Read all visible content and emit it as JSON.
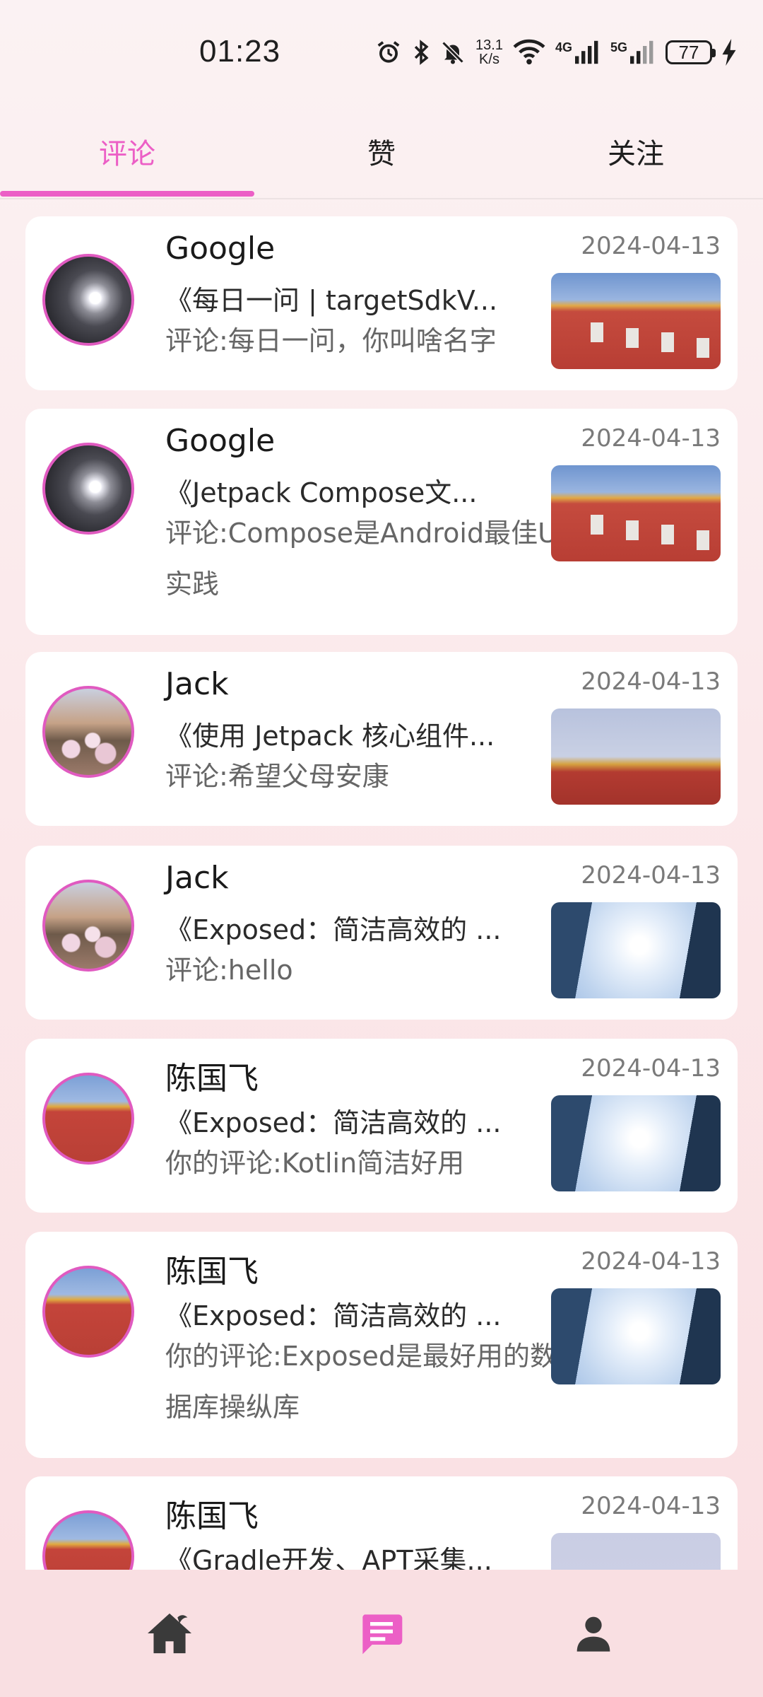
{
  "status_bar": {
    "time": "01:23",
    "net_speed_value": "13.1",
    "net_speed_unit": "K/s",
    "signal_1_label": "4G",
    "signal_2_label": "5G",
    "battery": "77"
  },
  "tabs": [
    {
      "label": "评论",
      "active": true
    },
    {
      "label": "赞",
      "active": false
    },
    {
      "label": "关注",
      "active": false
    }
  ],
  "accent_color": "#ec5fc6",
  "items": [
    {
      "name": "Google",
      "date": "2024-04-13",
      "article": "《每日一问 | targetSdkV...",
      "comment": "评论:每日一问，你叫啥名字",
      "avatar": "moon-night-avatar",
      "thumb": "palace-wall-thumbnail"
    },
    {
      "name": "Google",
      "date": "2024-04-13",
      "article": "《Jetpack Compose文...",
      "comment": "评论:Compose是Android最佳UI实践",
      "avatar": "moon-night-avatar",
      "thumb": "palace-wall-thumbnail"
    },
    {
      "name": "Jack",
      "date": "2024-04-13",
      "article": "《使用 Jetpack 核心组件...",
      "comment": "评论:希望父母安康",
      "avatar": "blossom-avatar",
      "thumb": "palace-gate-thumbnail"
    },
    {
      "name": "Jack",
      "date": "2024-04-13",
      "article": "《Exposed：简洁高效的 ...",
      "comment": "评论:hello",
      "avatar": "blossom-avatar",
      "thumb": "sky-buildings-thumbnail"
    },
    {
      "name": "陈国飞",
      "date": "2024-04-13",
      "article": "《Exposed：简洁高效的 ...",
      "comment": "你的评论:Kotlin简洁好用",
      "avatar": "palace-avatar",
      "thumb": "sky-buildings-thumbnail"
    },
    {
      "name": "陈国飞",
      "date": "2024-04-13",
      "article": "《Exposed：简洁高效的 ...",
      "comment": "你的评论:Exposed是最好用的数据库操纵库",
      "avatar": "palace-avatar",
      "thumb": "sky-buildings-thumbnail"
    },
    {
      "name": "陈国飞",
      "date": "2024-04-13",
      "article": "《Gradle开发、APT采集...",
      "comment": "",
      "avatar": "palace-avatar",
      "thumb": "faded-thumbnail"
    }
  ],
  "bottom_nav": [
    {
      "icon": "home-icon",
      "active": false
    },
    {
      "icon": "message-icon",
      "active": true
    },
    {
      "icon": "person-icon",
      "active": false
    }
  ]
}
